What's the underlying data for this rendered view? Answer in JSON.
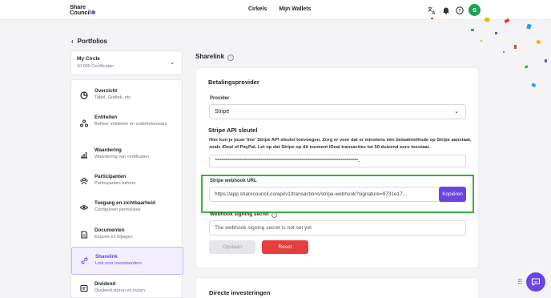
{
  "header": {
    "logo_line1": "Share",
    "logo_line2": "Council",
    "nav": [
      "Cirkels",
      "Mijn Wallets"
    ],
    "avatar_initial": "S"
  },
  "back_label": "Portfolios",
  "portfolio": {
    "name": "My Circle",
    "subtitle": "10.000 Certificaten"
  },
  "sidebar": {
    "items": [
      {
        "title": "Overzicht",
        "subtitle": "Tabel, Grafiek, etc.",
        "icon": "pie-chart-icon"
      },
      {
        "title": "Entiteiten",
        "subtitle": "Beheer entiteiten en ondertekenaars",
        "icon": "entities-icon"
      },
      {
        "title": "Waardering",
        "subtitle": "Waardering van certificaten",
        "icon": "bar-chart-icon"
      },
      {
        "title": "Participanten",
        "subtitle": "Participanten beheer",
        "icon": "users-icon"
      },
      {
        "title": "Toegang en zichtbaarheid",
        "subtitle": "Configureer permissies",
        "icon": "eye-lock-icon"
      },
      {
        "title": "Documenten",
        "subtitle": "Exports en bijlagen",
        "icon": "document-icon"
      },
      {
        "title": "Sharelink",
        "subtitle": "Link voor investeerders",
        "icon": "link-icon"
      },
      {
        "title": "Dividend",
        "subtitle": "Dividend sturen en inzien",
        "icon": "dividend-icon"
      }
    ],
    "active_index": 6
  },
  "main": {
    "section_title": "Sharelink",
    "card_title": "Betalingsprovider",
    "provider_label": "Provider",
    "provider_value": "Stripe",
    "api_title": "Stripe API sleutel",
    "api_desc": "Hier kun je jouw 'live' Stripe API sleutel toevoegen. Zorg er voor dat er minstens één betaalmethode op Stripe aanstaat, zoals iDeal of PayPal. Let op dat Stripe op dit moment iDeal transacties tot 50 duizend euro toestaat.",
    "api_key_masked": "*************************************************************************************************************...",
    "webhook_label": "Stripe webhook URL",
    "webhook_url": "https://app.sharecouncil.co/api/v1/transactions/stripe-webhook?signature=9731e17...",
    "copy_label": "Kopiëren",
    "secret_label": "Webhook signing secret",
    "secret_placeholder": "The webhook signing secret is not set yet",
    "save_label": "Opslaan",
    "reset_label": "Reset",
    "next_card_title": "Directe investeringen"
  },
  "colors": {
    "accent": "#6a45e3",
    "danger": "#e63d3d",
    "highlight": "#35b53c",
    "avatar": "#1da152"
  }
}
